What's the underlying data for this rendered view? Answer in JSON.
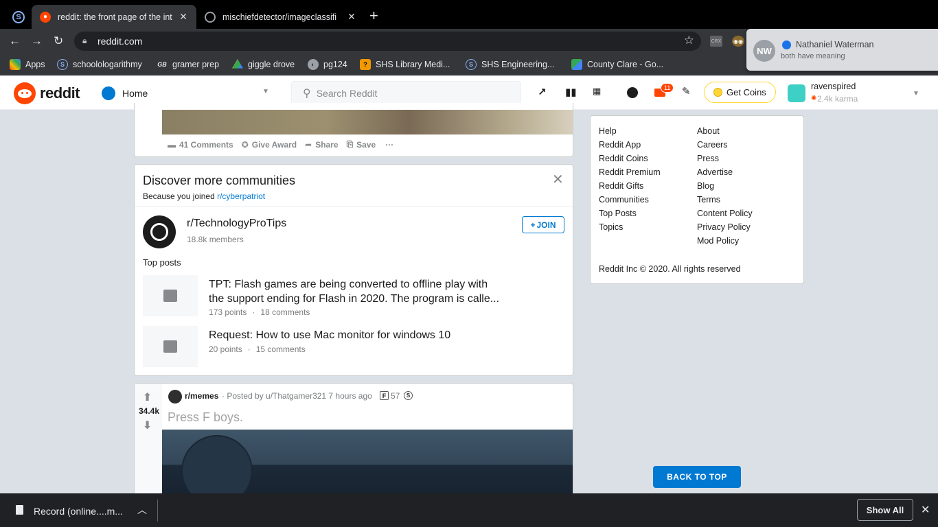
{
  "browser": {
    "tabs": [
      {
        "title": "reddit: the front page of the int",
        "active": true
      },
      {
        "title": "mischiefdetector/imageclassifi",
        "active": false
      }
    ],
    "url": "reddit.com",
    "bookmarks": [
      "Apps",
      "schoolologarithmy",
      "gramer prep",
      "giggle drove",
      "pg124",
      "SHS Library Medi...",
      "SHS Engineering...",
      "County Clare - Go..."
    ],
    "ext_crx": "CRX"
  },
  "notification": {
    "initials": "NW",
    "name": "Nathaniel Waterman",
    "message": "both have meaning"
  },
  "header": {
    "logo_text": "reddit",
    "home_label": "Home",
    "search_placeholder": "Search Reddit",
    "mail_count": "11",
    "get_coins": "Get Coins",
    "username": "ravenspired",
    "karma": "2.4k karma"
  },
  "post1": {
    "comments": "41 Comments",
    "give_award": "Give Award",
    "share": "Share",
    "save": "Save"
  },
  "discover": {
    "title": "Discover more communities",
    "because": "Because you joined",
    "joined_sub": "r/cyberpatriot",
    "community": "r/TechnologyProTips",
    "members": "18.8k members",
    "join": "JOIN",
    "top_posts_label": "Top posts",
    "top_posts": [
      {
        "title_line1": "TPT: Flash games are being converted to offline play with",
        "title_line2": "the support ending for Flash in 2020. The program is calle...",
        "points": "173 points",
        "comments": "18 comments"
      },
      {
        "title_line1": "Request: How to use Mac monitor for windows 10",
        "title_line2": "",
        "points": "20 points",
        "comments": "15 comments"
      }
    ]
  },
  "post2": {
    "votes": "34.4k",
    "subreddit": "r/memes",
    "posted_by": "· Posted by u/Thatgamer321 7 hours ago",
    "award_count": "57",
    "title": "Press F boys."
  },
  "footer": {
    "col1": [
      "Help",
      "Reddit App",
      "Reddit Coins",
      "Reddit Premium",
      "Reddit Gifts",
      "Communities",
      "Top Posts",
      "Topics"
    ],
    "col2": [
      "About",
      "Careers",
      "Press",
      "Advertise",
      "Blog",
      "Terms",
      "Content Policy",
      "Privacy Policy",
      "Mod Policy"
    ],
    "copyright": "Reddit Inc © 2020. All rights reserved"
  },
  "back_to_top": "BACK TO TOP",
  "download": {
    "file": "Record (online....m...",
    "show_all": "Show All"
  },
  "colors": {
    "reddit_orange": "#ff4500",
    "reddit_blue": "#0079d3",
    "page_bg": "#dae0e6"
  }
}
